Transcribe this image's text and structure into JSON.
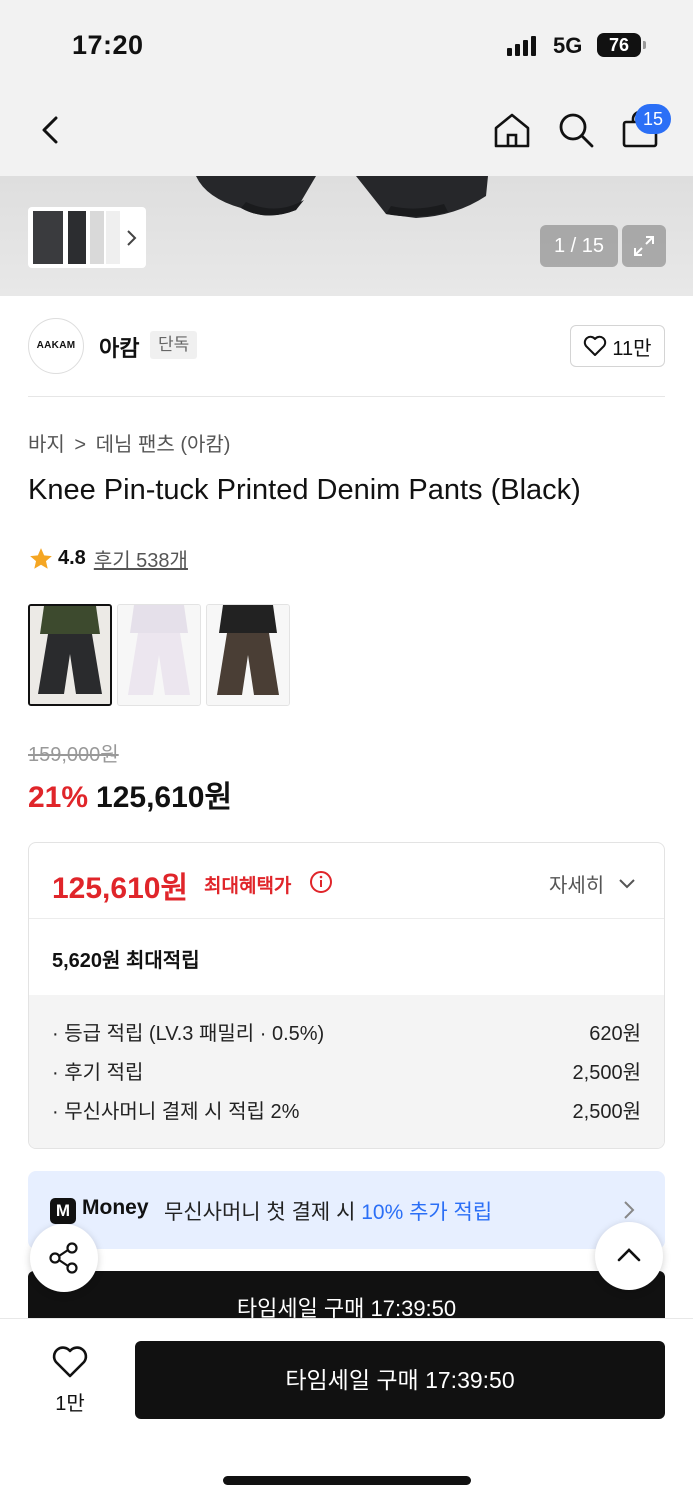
{
  "status": {
    "time": "17:20",
    "network": "5G",
    "battery": "76"
  },
  "nav": {
    "cart_count": "15"
  },
  "gallery": {
    "pager": "1 / 15"
  },
  "brand": {
    "logo_text": "AAKAM",
    "name": "아캄",
    "tag": "단독",
    "likes": "11만"
  },
  "breadcrumb": {
    "items": [
      "바지",
      ">",
      "데님 팬츠 (아캄)"
    ]
  },
  "product": {
    "title": "Knee Pin-tuck Printed Denim Pants (Black)",
    "rating": "4.8",
    "reviews": "후기 538개",
    "original_price": "159,000원",
    "discount": "21%",
    "sale_price": "125,610원"
  },
  "colors": {
    "options": [
      "Black",
      "Light Purple",
      "Brown"
    ],
    "swatch_colors": [
      "#2a2b2d",
      "#ece6ef",
      "#4a3e35"
    ]
  },
  "benefit": {
    "max_price": "125,610원",
    "max_label": "최대혜택가",
    "detail": "자세히",
    "points_total": "5,620원 최대적립",
    "rows": [
      {
        "label": "· 등급 적립 (LV.3 패밀리 · 0.5%)",
        "value": "620원"
      },
      {
        "label": "· 후기 적립",
        "value": "2,500원"
      },
      {
        "label": "· 무신사머니 결제 시 적립 2%",
        "value": "2,500원"
      }
    ]
  },
  "money": {
    "icon_letter": "M",
    "brand": "Money",
    "text_before": "무신사머니 첫 결제 시 ",
    "text_accent": "10% 추가 적립"
  },
  "buy": {
    "label": "타임세일 구매 17:39:50",
    "wish_count": "1만"
  },
  "colors_ui": {
    "accent_red": "#e0252a",
    "accent_blue": "#2b6ff6"
  }
}
